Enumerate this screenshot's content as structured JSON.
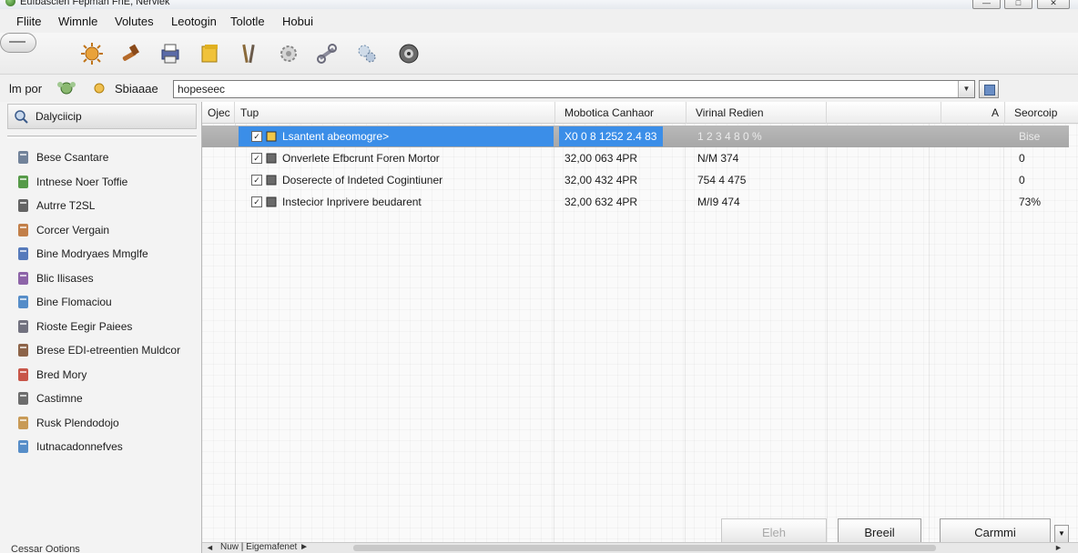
{
  "window": {
    "title": "Eufbasclen Fepman FnE, Nerviek",
    "min": "—",
    "max": "□",
    "close": "✕"
  },
  "menu": [
    "Fliite",
    "Wimnle",
    "Volutes",
    "Leotogin",
    "Tolotle",
    "Hobui"
  ],
  "toolbar": {
    "icons": [
      "pill-icon",
      "sun-gear-icon",
      "hammer-icon",
      "printer-icon",
      "folder-icon",
      "tools-icon",
      "gear-icon",
      "wrench-icon",
      "cog-cluster-icon",
      "disc-icon"
    ]
  },
  "addressbar": {
    "label1": "lm por",
    "label2": "Sbiaaae",
    "value": "hopeseec",
    "dropdown": "▼"
  },
  "sidebar": {
    "header": "Dalyciicip",
    "items": [
      {
        "label": "Bese Csantare",
        "icon": "document-icon",
        "color": "#5a6e8a"
      },
      {
        "label": "Intnese Noer Toffie",
        "icon": "leaf-icon",
        "color": "#3a8a2a"
      },
      {
        "label": "Autrre T2SL",
        "icon": "database-icon",
        "color": "#4a4a4a"
      },
      {
        "label": "Corcer Vergain",
        "icon": "bottle-icon",
        "color": "#b86a2a"
      },
      {
        "label": "Bine Modryaes Mmglfe",
        "icon": "puzzle-icon",
        "color": "#3a64b0"
      },
      {
        "label": "Blic Ilisases",
        "icon": "user-icon",
        "color": "#7a4a9a"
      },
      {
        "label": "Bine Flomaciou",
        "icon": "flask-icon",
        "color": "#3a7ac0"
      },
      {
        "label": "Rioste Eegir Paiees",
        "icon": "monitor-icon",
        "color": "#5a5a6a"
      },
      {
        "label": "Brese EDI-etreentien Muldcor",
        "icon": "grid-icon",
        "color": "#7a4a2a"
      },
      {
        "label": "Bred Mory",
        "icon": "shield-icon",
        "color": "#c03a2a"
      },
      {
        "label": "Castimne",
        "icon": "person-icon",
        "color": "#555555"
      },
      {
        "label": "Rusk Plendodojo",
        "icon": "hand-icon",
        "color": "#c08a3a"
      },
      {
        "label": "Iutnacadonnefves",
        "icon": "page-icon",
        "color": "#3a7ac0"
      }
    ],
    "footer": "Cessar Ootions"
  },
  "list": {
    "columns": [
      "Ojec",
      "Tup",
      "Mobotica Canhaor",
      "Virinal Redien",
      "A",
      "Seorcoip"
    ],
    "rows": [
      {
        "name": "Lsantent abeomogre>",
        "c2": "X0 0 8 1252 2.4 83",
        "c3": "1 2 3 4 8 0 %",
        "c4": "Bise",
        "selected": true
      },
      {
        "name": "Onverlete Efbcrunt Foren Mortor",
        "c2": "32,00 063 4PR",
        "c3": "N/M 374",
        "c4": "0",
        "selected": false
      },
      {
        "name": "Doserecte of Indeted Cogintiuner",
        "c2": "32,00 432 4PR",
        "c3": "754 4 475",
        "c4": "0",
        "selected": false
      },
      {
        "name": "Instecior Inprivere beudarent",
        "c2": "32,00 632 4PR",
        "c3": "M/I9 474",
        "c4": "73%",
        "selected": false
      }
    ]
  },
  "buttons": {
    "back": "Eleh",
    "detail": "Breeil",
    "commit": "Carmmi",
    "drop": "▼"
  },
  "statusbar": {
    "left": "◄",
    "label": "Nuw  |  Eigemafenet  ►",
    "right": "►"
  }
}
